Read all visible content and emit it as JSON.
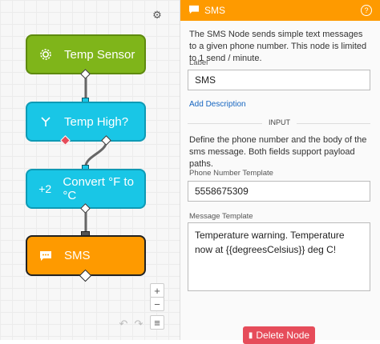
{
  "canvas": {
    "nodes": [
      {
        "label": "Temp Sensor",
        "icon": "gear-icon"
      },
      {
        "label": "Temp High?",
        "icon": "branch-icon"
      },
      {
        "label": "Convert °F to °C",
        "icon_text": "+2"
      },
      {
        "label": "SMS",
        "icon": "message-icon"
      }
    ],
    "zoom_in": "+",
    "zoom_out": "−",
    "settings_icon": "gear-icon"
  },
  "panel": {
    "title": "SMS",
    "help": "?",
    "description": "The SMS Node sends simple text messages to a given phone number. This node is limited to 1 send / minute.",
    "label_caption": "Label",
    "label_value": "SMS",
    "add_description": "Add Description",
    "input_section": "INPUT",
    "input_description": "Define the phone number and the body of the sms message. Both fields support payload paths.",
    "phone_caption": "Phone Number Template",
    "phone_value": "5558675309",
    "message_caption": "Message Template",
    "message_value": "Temperature warning. Temperature now at {{degreesCelsius}} deg C!",
    "delete_button": "Delete Node"
  },
  "colors": {
    "orange": "#fe9a00",
    "green": "#7fb51a",
    "cyan": "#19c6e6",
    "red": "#e64c5a"
  }
}
